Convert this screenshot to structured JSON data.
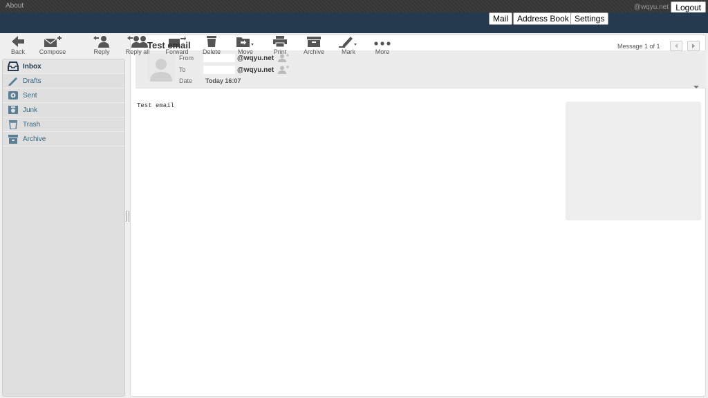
{
  "topbar": {
    "about": "About",
    "user": "@wqyu.net",
    "logout": "Logout"
  },
  "nav": {
    "mail": "Mail",
    "addressbook": "Address Book",
    "settings": "Settings"
  },
  "toolbar": {
    "back": "Back",
    "compose": "Compose",
    "reply": "Reply",
    "replyall": "Reply all",
    "forward": "Forward",
    "delete": "Delete",
    "move": "Move",
    "print": "Print",
    "archive": "Archive",
    "mark": "Mark",
    "more": "More"
  },
  "folders": [
    {
      "label": "Inbox",
      "icon": "inbox-icon"
    },
    {
      "label": "Drafts",
      "icon": "pencil-icon"
    },
    {
      "label": "Sent",
      "icon": "sent-icon"
    },
    {
      "label": "Junk",
      "icon": "junk-icon"
    },
    {
      "label": "Trash",
      "icon": "trash-icon"
    },
    {
      "label": "Archive",
      "icon": "archive-icon"
    }
  ],
  "message": {
    "subject": "Test email",
    "count": "Message 1 of 1",
    "from_label": "From",
    "to_label": "To",
    "date_label": "Date",
    "from": "@wqyu.net",
    "to": "@wqyu.net",
    "date": "Today 16:07",
    "body": "Test email"
  },
  "colors": {
    "header": "#263a4f",
    "topbar": "#3a3a3a",
    "folder_text": "#37637c"
  }
}
